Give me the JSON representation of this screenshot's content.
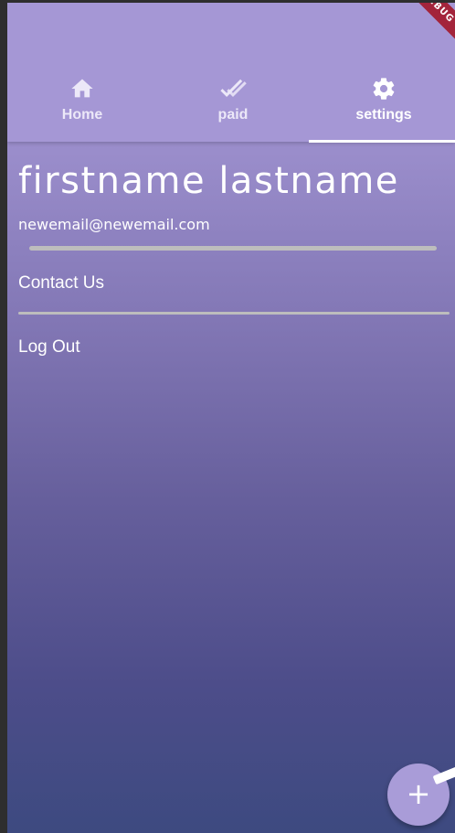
{
  "tabs": [
    {
      "label": "Home",
      "icon": "home-icon"
    },
    {
      "label": "paid",
      "icon": "checkmark-icon"
    },
    {
      "label": "settings",
      "icon": "gear-icon"
    }
  ],
  "active_tab": "settings",
  "debug_banner": "DEBUG",
  "profile": {
    "name": "firstname lastname",
    "email": "newemail@newemail.com"
  },
  "menu": {
    "contact": "Contact Us",
    "logout": "Log Out"
  },
  "fab": {
    "label": "+",
    "icon": "plus-icon"
  },
  "colors": {
    "appbar": "#a597d5",
    "gradient_top": "#a597d5",
    "gradient_bottom": "#3d4a80",
    "fab": "#a99cd8",
    "banner": "#a3243b"
  }
}
